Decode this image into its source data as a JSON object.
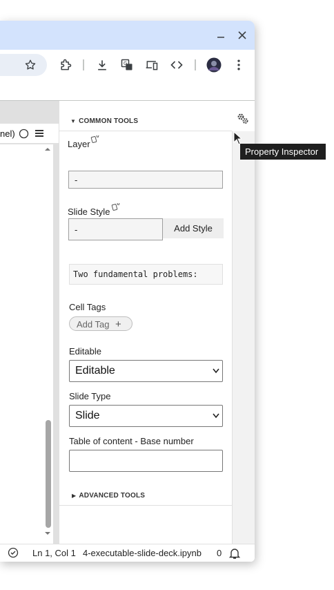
{
  "titlebar": {
    "minimize_icon": "minimize-icon",
    "close_icon": "close-icon"
  },
  "toolbar": {
    "icons": [
      "bookmark-star-icon",
      "extensions-icon",
      "download-icon",
      "translate-icon",
      "device-icon",
      "devtools-icon",
      "profile-avatar",
      "more-menu-icon"
    ]
  },
  "kernel": {
    "label": "nel)"
  },
  "inspector": {
    "common_tools": "COMMON TOOLS",
    "layer_label": "Layer",
    "layer_value": "-",
    "slide_style_label": "Slide Style",
    "slide_style_value": "-",
    "add_style": "Add Style",
    "cell_preview": "Two fundamental problems:",
    "cell_tags_label": "Cell Tags",
    "add_tag": "Add Tag",
    "editable_label": "Editable",
    "editable_value": "Editable",
    "slide_type_label": "Slide Type",
    "slide_type_value": "Slide",
    "toc_label": "Table of content - Base number",
    "toc_value": "",
    "advanced_tools": "ADVANCED TOOLS"
  },
  "tooltip": {
    "text": "Property Inspector"
  },
  "status": {
    "position": "Ln 1, Col 1",
    "filename": "4-executable-slide-deck.ipynb",
    "count": "0"
  },
  "colors": {
    "titlebar": "#d3e3fd",
    "tooltip_bg": "#1f1f1f"
  }
}
